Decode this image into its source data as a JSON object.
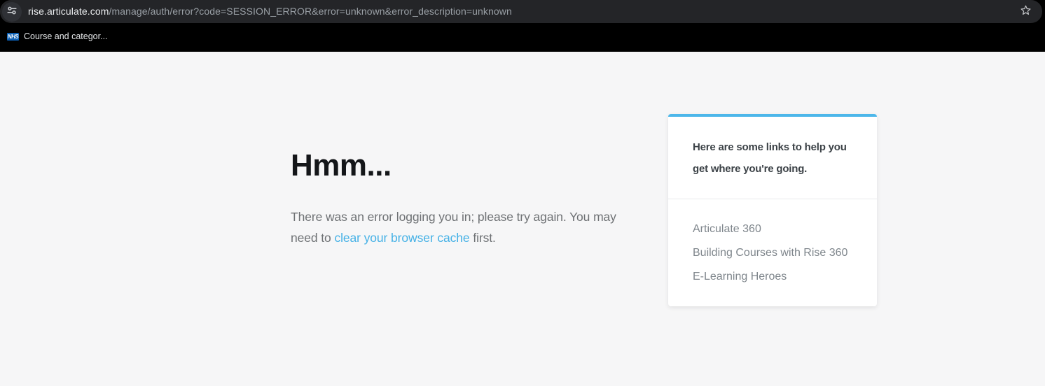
{
  "browser": {
    "url": {
      "domain": "rise.articulate.com",
      "path": "/manage/auth/error?code=SESSION_ERROR&error=unknown&error_description=unknown"
    },
    "bookmarks_bar": {
      "bookmark": {
        "favicon_text": "NHS",
        "label": "Course and categor..."
      }
    }
  },
  "main": {
    "error": {
      "heading": "Hmm...",
      "message_before_link": "There was an error logging you in; please try again. You may\nneed to ",
      "message_link": "clear your browser cache",
      "message_after_link": " first."
    },
    "help_card": {
      "title": "Here are some links to help you\nget where you're going.",
      "links": [
        "Articulate 360",
        "Building Courses with Rise 360",
        "E-Learning Heroes"
      ]
    }
  },
  "colors": {
    "accent_blue": "#4db7ea",
    "link_blue": "#45b1e6",
    "page_background": "#f6f6f7",
    "chrome_background": "#000000",
    "url_bar_background": "#242528",
    "bookmark_favicon_blue": "#0b5fb4"
  }
}
